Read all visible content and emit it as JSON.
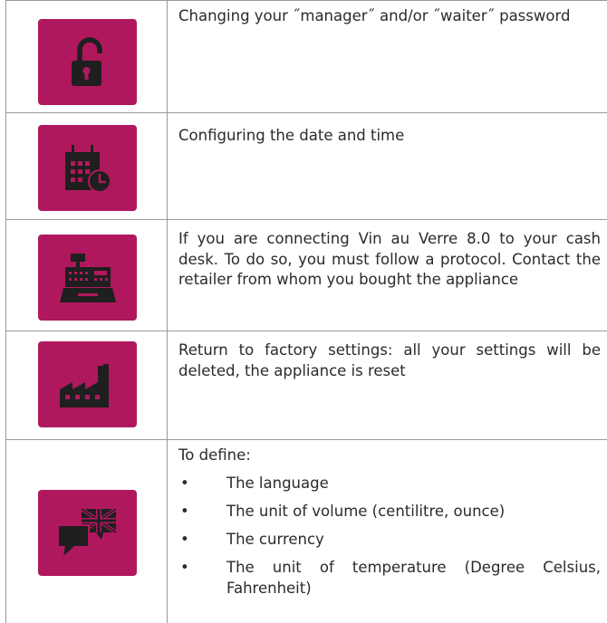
{
  "rows": [
    {
      "icon": "unlocked-padlock-icon",
      "text": "Changing your ˝manager˝ and/or ˝waiter˝ password"
    },
    {
      "icon": "calendar-clock-icon",
      "text": "Configuring the date and time"
    },
    {
      "icon": "cash-register-icon",
      "text": "If you are connecting Vin au Verre 8.0 to your cash desk. To do so, you must follow a protocol. Contact the retailer from whom you bought the appliance"
    },
    {
      "icon": "factory-icon",
      "text": "Return to factory settings: all your settings will be deleted, the appliance is reset"
    },
    {
      "icon": "language-speech-bubbles-flag-icon",
      "intro": "To define:",
      "bullet_symbol": "•",
      "items": [
        "The language",
        "The unit of volume (centilitre, ounce)",
        "The currency",
        "The unit of temperature (Degree Celsius, Fahrenheit)"
      ]
    }
  ],
  "colors": {
    "tile": "#b0185d",
    "icon": "#1f1f1f",
    "border": "#9a9a9a"
  }
}
